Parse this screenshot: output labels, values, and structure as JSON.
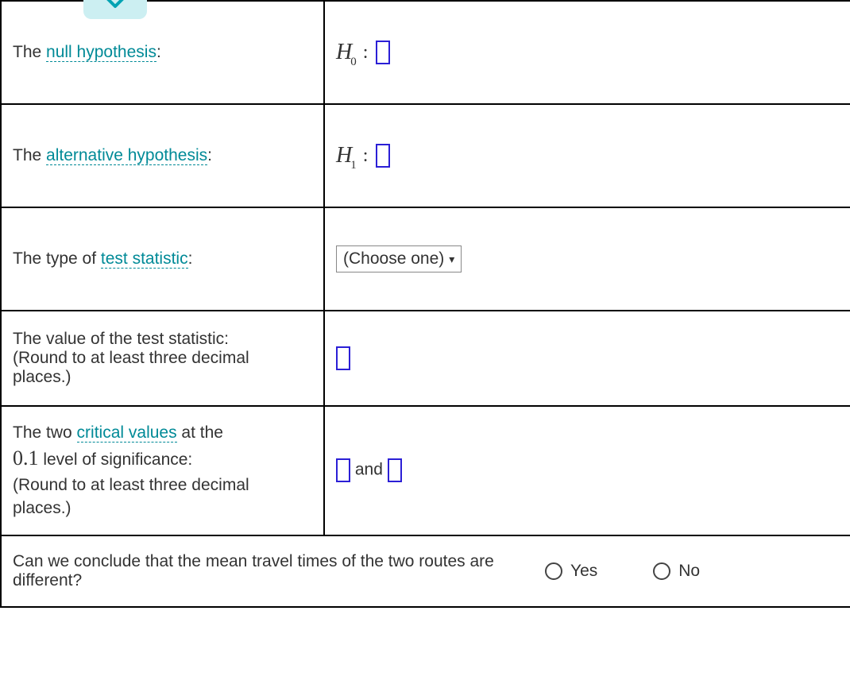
{
  "rows": {
    "r1": {
      "pre": "The ",
      "link": "null hypothesis",
      "post": ":",
      "sym": "H",
      "sub": "0",
      "colon": ":"
    },
    "r2": {
      "pre": "The ",
      "link": "alternative hypothesis",
      "post": ":",
      "sym": "H",
      "sub": "1",
      "colon": ":"
    },
    "r3": {
      "pre": "The type of ",
      "link": "test statistic",
      "post": ":",
      "select": "(Choose one)"
    },
    "r4": {
      "line1": "The value of the test statistic:",
      "line2": "(Round to at least three decimal places.)"
    },
    "r5": {
      "pre": "The two ",
      "link": "critical values",
      "post": " at the ",
      "sig": "0.1",
      "tail": " level of significance:",
      "note": "(Round to at least three decimal places.)",
      "and": " and "
    },
    "r6": {
      "question": "Can we conclude that the mean travel times of the two routes are different?",
      "yes": "Yes",
      "no": "No"
    }
  }
}
